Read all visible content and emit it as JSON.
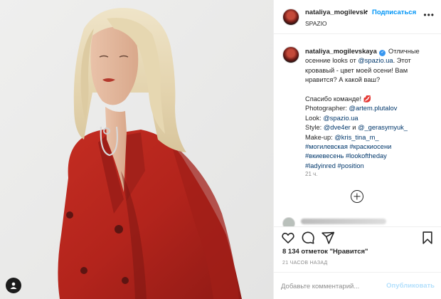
{
  "post": {
    "username": "nataliya_mogilevsk",
    "follow_separator": "•",
    "follow_label": "Подписаться",
    "location": "SPAZIO",
    "more_label": "•••"
  },
  "caption": {
    "username": "nataliya_mogilevskaya",
    "verified_mark": "✓",
    "text_1": " Отличные осенние looks от ",
    "mention_spazio": "@spazio.ua",
    "text_2": ". Этот кровавый - цвет моей осени! Вам нравится? А какой ваш?",
    "thanks": "Спасибо команде! 💋",
    "photographer_label": "Photographer: ",
    "photographer": "@artem.plutalov",
    "look_label": "Look: ",
    "look": "@spazio.ua",
    "style_label": "Style: ",
    "style_1": "@dve4er",
    "style_and": " и ",
    "style_2": "@_gerasymyuk_",
    "makeup_label": "Make-up: ",
    "makeup": "@kris_tina_m_",
    "tags_1": "#могилевская",
    "tags_2": "#краскиосени",
    "tags_3": "#вкиевесень",
    "tags_4": "#lookoftheday",
    "tags_5": "#ladyinred",
    "tags_6": "#position",
    "time": "21 ч."
  },
  "actions": {
    "likes": "8 134 отметок \"Нравится\"",
    "posted": "21 часов назад"
  },
  "comment_box": {
    "placeholder": "Добавьте комментарий...",
    "publish": "Опубликовать"
  },
  "colors": {
    "accent": "#0095f6",
    "link": "#00376b",
    "coat_red": "#b8261e",
    "background": "#ececec"
  },
  "icons": [
    "heart-icon",
    "comment-icon",
    "share-icon",
    "bookmark-icon",
    "add-more-comments-icon",
    "user-tag-icon"
  ]
}
